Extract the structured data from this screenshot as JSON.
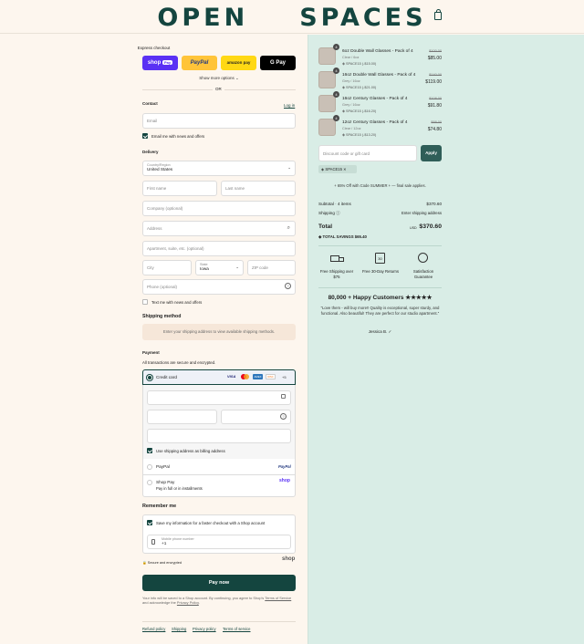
{
  "brand": {
    "part1": "OPEN",
    "part2": "SPACES"
  },
  "express": {
    "label": "Express checkout",
    "shop_pay": "shop",
    "shop_pay_tag": "Pay",
    "paypal": "PayPal",
    "amazon": "amazon pay",
    "gpay": "G Pay",
    "more": "Show more options",
    "or": "OR"
  },
  "contact": {
    "title": "Contact",
    "login": "Log in",
    "email_placeholder": "Email",
    "news_label": "Email me with news and offers"
  },
  "delivery": {
    "title": "Delivery",
    "country_label": "Country/Region",
    "country_value": "United States",
    "first_name": "First name",
    "last_name": "Last name",
    "company": "Company (optional)",
    "address": "Address",
    "apartment": "Apartment, suite, etc. (optional)",
    "city": "City",
    "state_label": "State",
    "state_value": "Iowa",
    "zip": "ZIP code",
    "phone": "Phone (optional)",
    "text_news": "Text me with news and offers"
  },
  "shipping_method": {
    "title": "Shipping method",
    "message": "Enter your shipping address to view available shipping methods."
  },
  "payment": {
    "title": "Payment",
    "subtitle": "All transactions are secure and encrypted.",
    "credit_card": "Credit card",
    "card_brands": [
      "VISA",
      "MC",
      "AMEX",
      "DISC",
      "+5"
    ],
    "billing_label": "Use shipping address as billing address",
    "paypal": "PayPal",
    "paypal_logo": "PayPal",
    "shop_pay": "Shop Pay",
    "shop_pay_sub": "Pay in full or in installments",
    "shop_pay_logo": "shop"
  },
  "remember": {
    "title": "Remember me",
    "save_label": "Save my information for a faster checkout with a Shop account",
    "mobile_label": "Mobile phone number",
    "mobile_value": "+1",
    "secure": "Secure and encrypted",
    "shop_logo": "shop"
  },
  "pay_button": "Pay now",
  "terms": {
    "line1": "Your info will be saved to a Shop account. By continuing, you agree to Shop’s",
    "tos": "Terms of Service",
    "mid": "and acknowledge the",
    "privacy": "Privacy Policy",
    "end": "."
  },
  "footer": {
    "refund": "Refund policy",
    "shipping": "Shipping",
    "privacy": "Privacy policy",
    "terms": "Terms of service"
  },
  "cart": {
    "items": [
      {
        "qty": "4",
        "title": "6oz Double Wall Glasses - Pack of 4",
        "sub": "Clear / 6oz",
        "discount": "SPACE15 (-$15.00)",
        "old": "$100.00",
        "price": "$85.00"
      },
      {
        "qty": "4",
        "title": "16oz Double Wall Glasses - Pack of 4",
        "sub": "Grey / 16oz",
        "discount": "SPACE15 (-$21.00)",
        "old": "$140.00",
        "price": "$119.00"
      },
      {
        "qty": "4",
        "title": "16oz Century Glasses - Pack of 4",
        "sub": "Grey / 16oz",
        "discount": "SPACE15 (-$16.20)",
        "old": "$108.00",
        "price": "$91.80"
      },
      {
        "qty": "4",
        "title": "12oz Century Glasses - Pack of 4",
        "sub": "Clear / 12oz",
        "discount": "SPACE15 (-$13.20)",
        "old": "$88.00",
        "price": "$74.80"
      }
    ],
    "discount_placeholder": "Discount code or gift card",
    "apply": "Apply",
    "code_tag": "SPACE15",
    "promo": "+ 65% Off with Code SUMMER + — final sale applies.",
    "subtotal_label": "Subtotal · 4 items",
    "subtotal_value": "$370.60",
    "shipping_label": "Shipping",
    "shipping_value": "Enter shipping address",
    "total_label": "Total",
    "currency": "USD",
    "total_value": "$370.60",
    "savings_label": "TOTAL SAVINGS",
    "savings_value": "$65.40"
  },
  "perks": [
    {
      "label": "Free Shipping over $75",
      "icon": "truck-icon"
    },
    {
      "label": "Free 30-Day Returns",
      "icon": "calendar-icon"
    },
    {
      "label": "Satisfaction Guarantee",
      "icon": "award-icon"
    }
  ],
  "reviews": {
    "title": "80,000 + Happy Customers ★★★★★",
    "quote": "“Love them - will buy more!! Quality is exceptional, super sturdy, and functional. Also beautiful! They are perfect for our studio apartment.”",
    "author": "Jessica B."
  },
  "colors": {
    "brand": "#14453f",
    "left_bg": "#fdf6ee",
    "right_bg": "#d9ede6",
    "shop_pay": "#5a31f4",
    "paypal": "#ffc439",
    "amazon": "#ffd814"
  }
}
